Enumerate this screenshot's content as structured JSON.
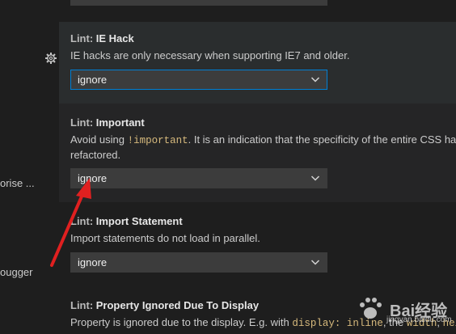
{
  "sidebar": {
    "items": [
      {
        "label": "orise ..."
      },
      {
        "label": "ougger"
      }
    ]
  },
  "settings": [
    {
      "category": "Lint: ",
      "name": "IE Hack",
      "description": "IE hacks are only necessary when supporting IE7 and older.",
      "value": "ignore"
    },
    {
      "category": "Lint: ",
      "name": "Important",
      "description_pre": "Avoid using ",
      "description_code": "!important",
      "description_post": ". It is an indication that the specificity of the entire CSS has",
      "description_line2": "refactored.",
      "value": "ignore"
    },
    {
      "category": "Lint: ",
      "name": "Import Statement",
      "description": "Import statements do not load in parallel.",
      "value": "ignore"
    },
    {
      "category": "Lint: ",
      "name": "Property Ignored Due To Display",
      "description_pre": "Property is ignored due to the display. E.g. with ",
      "description_code": "display: inline",
      "description_mid": ", the ",
      "description_code2": "width",
      "description_mid2": ", ",
      "description_code3": "heig"
    }
  ],
  "watermark": {
    "brand": "Bai经验",
    "url": "jingyan.baidu.com"
  },
  "colors": {
    "background": "#1e1e1e",
    "focus_border": "#007fd4",
    "code": "#d7ba7d",
    "arrow": "#e02020"
  }
}
